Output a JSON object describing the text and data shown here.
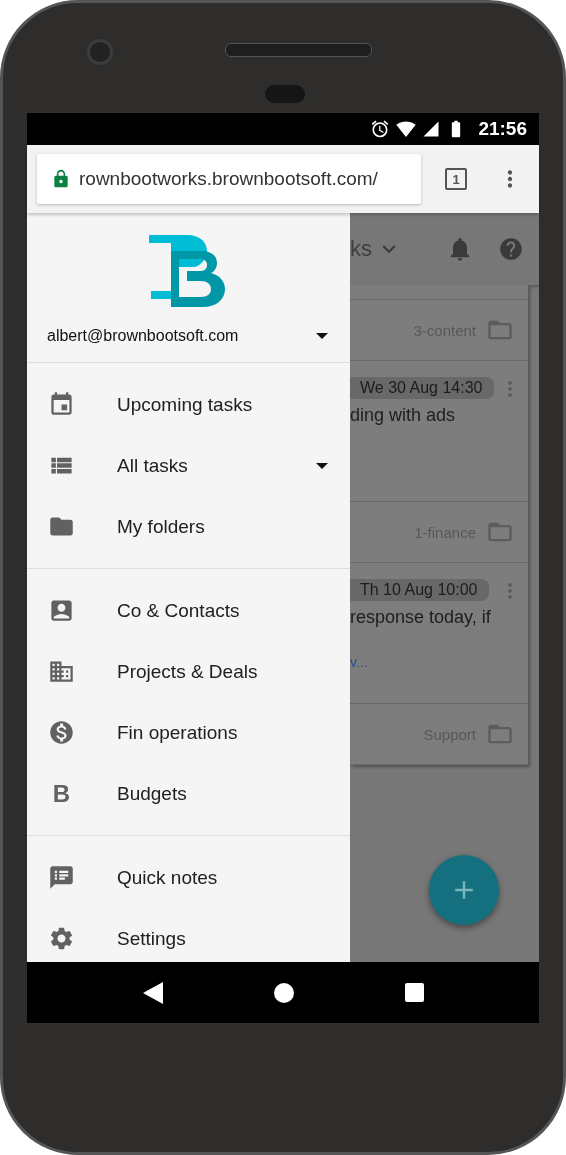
{
  "status_bar": {
    "time": "21:56"
  },
  "browser": {
    "url": "rownbootworks.brownbootsoft.com/",
    "tab_count": "1"
  },
  "background": {
    "title": "ks",
    "items": [
      {
        "kind": "folder",
        "label": "3-content"
      },
      {
        "kind": "task",
        "date": "We 30 Aug 14:30",
        "text": "ding with ads"
      },
      {
        "kind": "folder",
        "label": "1-finance"
      },
      {
        "kind": "task",
        "date": "Th 10 Aug 10:00",
        "text": "response today, if",
        "link": "v..."
      },
      {
        "kind": "folder",
        "label": "Support"
      }
    ]
  },
  "drawer": {
    "account": "albert@brownbootsoft.com",
    "groups": [
      [
        {
          "kind": "icon",
          "label": "Upcoming tasks",
          "expandable": false
        },
        {
          "kind": "icon",
          "label": "All tasks",
          "expandable": true
        },
        {
          "kind": "icon",
          "label": "My folders",
          "expandable": false
        }
      ],
      [
        {
          "kind": "icon",
          "label": "Co & Contacts",
          "expandable": false
        },
        {
          "kind": "icon",
          "label": "Projects & Deals",
          "expandable": false
        },
        {
          "kind": "icon",
          "label": "Fin operations",
          "expandable": false
        },
        {
          "kind": "glyph",
          "glyph": "B",
          "label": "Budgets",
          "expandable": false
        }
      ],
      [
        {
          "kind": "icon",
          "label": "Quick notes",
          "expandable": false
        },
        {
          "kind": "icon",
          "label": "Settings",
          "expandable": false
        }
      ]
    ]
  }
}
